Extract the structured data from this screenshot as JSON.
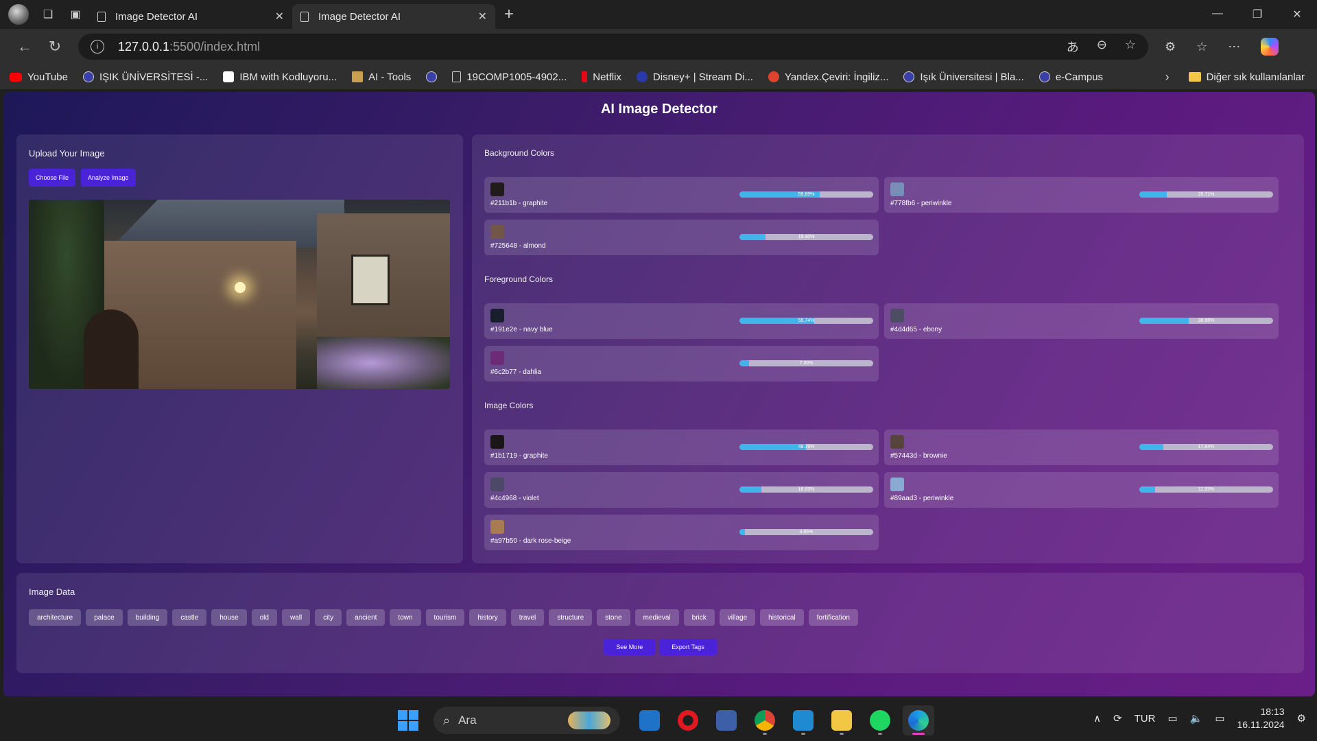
{
  "browser": {
    "tabs": [
      {
        "title": "Image Detector AI",
        "active": false
      },
      {
        "title": "Image Detector AI",
        "active": true
      }
    ],
    "url_host": "127.0.0.1",
    "url_path": ":5500/index.html",
    "bookmarks": [
      {
        "label": "YouTube",
        "color": "#ff0000"
      },
      {
        "label": "IŞIK ÜNİVERSİTESİ -...",
        "color": "#3b3fa8"
      },
      {
        "label": "IBM with Kodluyoru...",
        "color": "#ffffff"
      },
      {
        "label": "AI - Tools",
        "color": "#c8a050"
      },
      {
        "label": "",
        "color": "#3b3fa8"
      },
      {
        "label": "19COMP1005-4902...",
        "color": "#cccccc"
      },
      {
        "label": "Netflix",
        "color": "#e50914"
      },
      {
        "label": "Disney+ | Stream Di...",
        "color": "#2a3aa8"
      },
      {
        "label": "Yandex.Çeviri: İngiliz...",
        "color": "#e0442c"
      },
      {
        "label": "Işık Üniversitesi | Bla...",
        "color": "#3b3fa8"
      },
      {
        "label": "e-Campus",
        "color": "#3b3fa8"
      }
    ],
    "other_favorites": "Diğer sık kullanılanlar"
  },
  "app": {
    "title": "AI Image Detector",
    "upload": {
      "heading": "Upload Your Image",
      "choose_label": "Choose File",
      "analyze_label": "Analyze Image"
    },
    "background": {
      "heading": "Background Colors",
      "items": [
        {
          "label": "#211b1b - graphite",
          "hex": "#211b1b",
          "percent": 59.89,
          "percent_label": "59.89%"
        },
        {
          "label": "#778fb6 - periwinkle",
          "hex": "#778fb6",
          "percent": 20.71,
          "percent_label": "20.71%"
        },
        {
          "label": "#725648 - almond",
          "hex": "#725648",
          "percent": 19.4,
          "percent_label": "19.40%"
        }
      ]
    },
    "foreground": {
      "heading": "Foreground Colors",
      "items": [
        {
          "label": "#191e2e - navy blue",
          "hex": "#191e2e",
          "percent": 55.74,
          "percent_label": "55.74%"
        },
        {
          "label": "#4d4d65 - ebony",
          "hex": "#4d4d65",
          "percent": 36.96,
          "percent_label": "36.96%"
        },
        {
          "label": "#6c2b77 - dahlia",
          "hex": "#6c2b77",
          "percent": 7.3,
          "percent_label": "7.30%"
        }
      ]
    },
    "image_colors": {
      "heading": "Image Colors",
      "items": [
        {
          "label": "#1b1719 - graphite",
          "hex": "#1b1719",
          "percent": 49.76,
          "percent_label": "49.76%"
        },
        {
          "label": "#57443d - brownie",
          "hex": "#57443d",
          "percent": 17.84,
          "percent_label": "17.84%"
        },
        {
          "label": "#4c4968 - violet",
          "hex": "#4c4968",
          "percent": 16.63,
          "percent_label": "16.63%"
        },
        {
          "label": "#89aad3 - periwinkle",
          "hex": "#89aad3",
          "percent": 11.93,
          "percent_label": "11.93%"
        },
        {
          "label": "#a97b50 - dark rose-beige",
          "hex": "#a97b50",
          "percent": 3.85,
          "percent_label": "3.85%"
        }
      ]
    },
    "image_data": {
      "heading": "Image Data",
      "tags": [
        "architecture",
        "palace",
        "building",
        "castle",
        "house",
        "old",
        "wall",
        "city",
        "ancient",
        "town",
        "tourism",
        "history",
        "travel",
        "structure",
        "stone",
        "medieval",
        "brick",
        "village",
        "historical",
        "fortification"
      ],
      "see_more_label": "See More",
      "export_label": "Export Tags"
    }
  },
  "taskbar": {
    "search_placeholder": "Ara",
    "language": "TUR",
    "time": "18:13",
    "date": "16.11.2024"
  }
}
